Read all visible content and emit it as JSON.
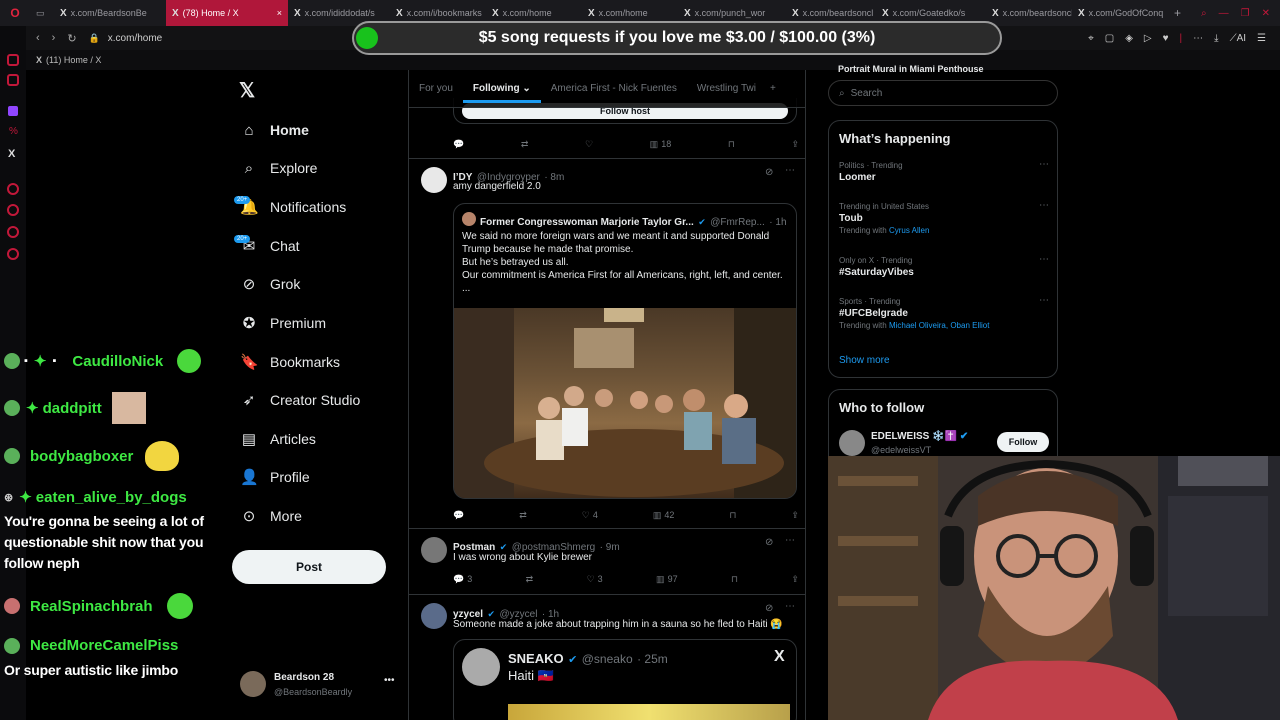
{
  "browser": {
    "tabs": [
      {
        "label": "x.com/BeardsonBe"
      },
      {
        "label": "(78) Home / X",
        "active": true
      },
      {
        "label": "x.com/ididdodat/s"
      },
      {
        "label": "x.com/i/bookmarks"
      },
      {
        "label": "x.com/home"
      },
      {
        "label": "x.com/home"
      },
      {
        "label": "x.com/punch_wor"
      },
      {
        "label": "x.com/beardsoncl"
      },
      {
        "label": "x.com/Goatedko/s"
      },
      {
        "label": "x.com/beardsoncli"
      },
      {
        "label": "x.com/GodOfConq"
      }
    ],
    "url": "x.com/home",
    "page_tab_label": "(11) Home / X"
  },
  "banner": {
    "text": "$5 song requests if you love me $3.00 / $100.00 (3%)",
    "progress": 0.03
  },
  "nav": {
    "items": [
      {
        "label": "Home",
        "icon": "home-icon"
      },
      {
        "label": "Explore",
        "icon": "search-icon"
      },
      {
        "label": "Notifications",
        "icon": "bell-icon",
        "badge": "20+"
      },
      {
        "label": "Chat",
        "icon": "chat-icon",
        "badge": "20+"
      },
      {
        "label": "Grok",
        "icon": "grok-icon"
      },
      {
        "label": "Premium",
        "icon": "premium-icon"
      },
      {
        "label": "Bookmarks",
        "icon": "bookmark-icon"
      },
      {
        "label": "Creator Studio",
        "icon": "rocket-icon"
      },
      {
        "label": "Articles",
        "icon": "articles-icon"
      },
      {
        "label": "Profile",
        "icon": "profile-icon"
      },
      {
        "label": "More",
        "icon": "more-icon"
      }
    ],
    "post_label": "Post",
    "account": {
      "name": "Beardson 28",
      "handle": "@BeardsonBeardly"
    }
  },
  "feed": {
    "tabs": [
      "For you",
      "Following",
      "America First - Nick Fuentes",
      "Wrestling Twi"
    ],
    "top_partial": {
      "button_label": "Follow host",
      "views": "18"
    },
    "tweets": [
      {
        "name": "I’DY",
        "handle": "@Indygroyper",
        "time": "· 8m",
        "text": "amy dangerfield 2.0",
        "quote": {
          "name": "Former Congresswoman Marjorie Taylor Gr...",
          "handle": "@FmrRep...",
          "time": "· 1h",
          "text": "We said no more foreign wars and we meant it and supported Donald Trump because he made that promise.\nBut he’s betrayed us all.\nOur commitment is America First for all Americans, right, left, and center. ..."
        },
        "likes": "4",
        "views": "42"
      },
      {
        "name": "Postman",
        "handle": "@postmanShmerg",
        "time": "· 9m",
        "text": "I was wrong about Kylie brewer",
        "replies": "3",
        "likes": "3",
        "views": "97"
      },
      {
        "name": "yzycel",
        "handle": "@yzycel",
        "time": "· 1h",
        "text": "Someone made a joke about trapping him in a sauna so he fled to Haiti 😭",
        "quote": {
          "name": "SNEAKO",
          "handle": "@sneako",
          "time": "· 25m",
          "text": "Haiti 🇭🇹"
        }
      }
    ]
  },
  "sidebar": {
    "partial_top": "Portrait Mural in Miami Penthouse",
    "search_placeholder": "Search",
    "happening_title": "What’s happening",
    "trends": [
      {
        "meta": "Politics · Trending",
        "name": "Loomer"
      },
      {
        "meta": "Trending in United States",
        "name": "Toub",
        "with_label": "Trending with",
        "with": "Cyrus Allen"
      },
      {
        "meta": "Only on X · Trending",
        "name": "#SaturdayVibes"
      },
      {
        "meta": "Sports · Trending",
        "name": "#UFCBelgrade",
        "with_label": "Trending with",
        "with": "Michael Oliveira, Oban Elliot"
      }
    ],
    "show_more": "Show more",
    "who_to_follow_title": "Who to follow",
    "follow_suggestion": {
      "name": "EDELWEISS ❄️✝️",
      "handle": "@edelweissVT",
      "button": "Follow"
    }
  },
  "chat": {
    "messages": [
      {
        "user": "CaudilloNick"
      },
      {
        "user": "daddpitt"
      },
      {
        "user": "bodybagboxer"
      },
      {
        "user": "eaten_alive_by_dogs",
        "text": "You're gonna be seeing a lot of questionable shit now that you follow neph"
      },
      {
        "user": "RealSpinachbrah"
      },
      {
        "user": "NeedMoreCamelPiss",
        "text": "Or super autistic like jimbo"
      }
    ]
  },
  "colors": {
    "accent": "#1d9bf0",
    "chat_name": "#3ee843",
    "active_tab": "#b0173a",
    "banner_dot": "#18c21c"
  }
}
